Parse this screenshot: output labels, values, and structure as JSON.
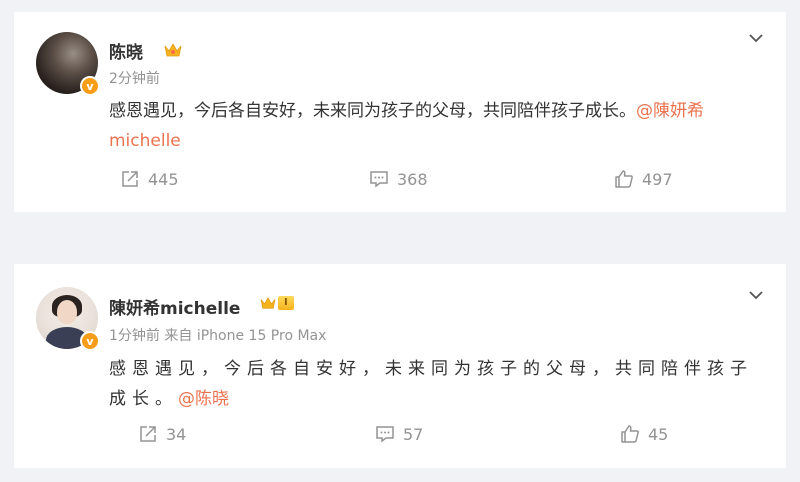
{
  "posts": [
    {
      "author": "陈晓",
      "author_badge_icon": "crown-icon",
      "verified_badge": "v",
      "time": "2分钟前",
      "source": "",
      "text": "感恩遇见，今后各自安好，未来同为孩子的父母，共同陪伴孩子成长。",
      "mention_line1": "@陳妍希",
      "mention_line2": "michelle",
      "reposts": "445",
      "comments": "368",
      "likes": "497"
    },
    {
      "author": "陳妍希michelle",
      "author_badge_icon": "crown-level-icon",
      "level_label": "I",
      "verified_badge": "v",
      "time": "1分钟前",
      "source": "来自 iPhone 15 Pro Max",
      "text_line1": "感恩遇见，今后各自安好，未来同为孩子的父母，共同陪伴孩子",
      "text_line2": "成长。",
      "mention": "@陈晓",
      "reposts": "34",
      "comments": "57",
      "likes": "45"
    }
  ],
  "colors": {
    "accent": "#eb7350",
    "meta": "#939393",
    "verified": "#f89d18",
    "background": "#f1f2f5"
  }
}
